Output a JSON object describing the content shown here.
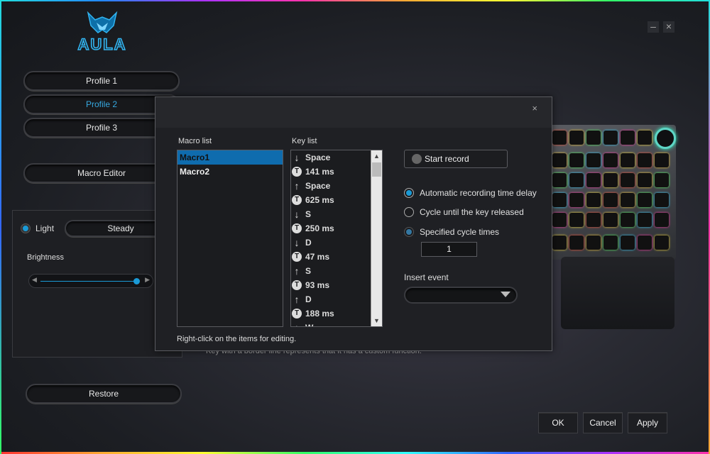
{
  "app": {
    "logo_text": "AULA",
    "minimize_glyph": "–",
    "close_glyph": "×"
  },
  "sidebar": {
    "profiles": [
      {
        "label": "Profile 1",
        "active": false
      },
      {
        "label": "Profile 2",
        "active": true
      },
      {
        "label": "Profile 3",
        "active": false
      }
    ],
    "macro_editor_label": "Macro Editor",
    "light_label": "Light",
    "light_mode": "Steady",
    "brightness_label": "Brightness",
    "brightness_value": 0.9,
    "restore_label": "Restore"
  },
  "behind_hint": "Key with a border line represents that it has a custom function.",
  "footer": {
    "ok_label": "OK",
    "cancel_label": "Cancel",
    "apply_label": "Apply"
  },
  "macro_dialog": {
    "close_glyph": "×",
    "macro_list_label": "Macro list",
    "macros": [
      {
        "name": "Macro1",
        "selected": true
      },
      {
        "name": "Macro2",
        "selected": false
      }
    ],
    "key_list_label": "Key list",
    "keys": [
      {
        "kind": "down",
        "text": "Space"
      },
      {
        "kind": "time",
        "text": "141 ms"
      },
      {
        "kind": "up",
        "text": "Space"
      },
      {
        "kind": "time",
        "text": "625 ms"
      },
      {
        "kind": "down",
        "text": "S"
      },
      {
        "kind": "time",
        "text": "250 ms"
      },
      {
        "kind": "down",
        "text": "D"
      },
      {
        "kind": "time",
        "text": "47 ms"
      },
      {
        "kind": "up",
        "text": "S"
      },
      {
        "kind": "time",
        "text": "93 ms"
      },
      {
        "kind": "up",
        "text": "D"
      },
      {
        "kind": "time",
        "text": "188 ms"
      },
      {
        "kind": "down",
        "text": "W"
      }
    ],
    "start_record_label": "Start record",
    "options": [
      {
        "label": "Automatic recording time delay",
        "selected": true
      },
      {
        "label": "Cycle until the key released",
        "selected": false
      },
      {
        "label": "Specified cycle times",
        "selected": true
      }
    ],
    "cycle_times": "1",
    "insert_event_label": "Insert event",
    "hint": "Right-click on the items for editing."
  },
  "colors": {
    "accent": "#1a9ad6",
    "selection": "#0f6cae"
  }
}
